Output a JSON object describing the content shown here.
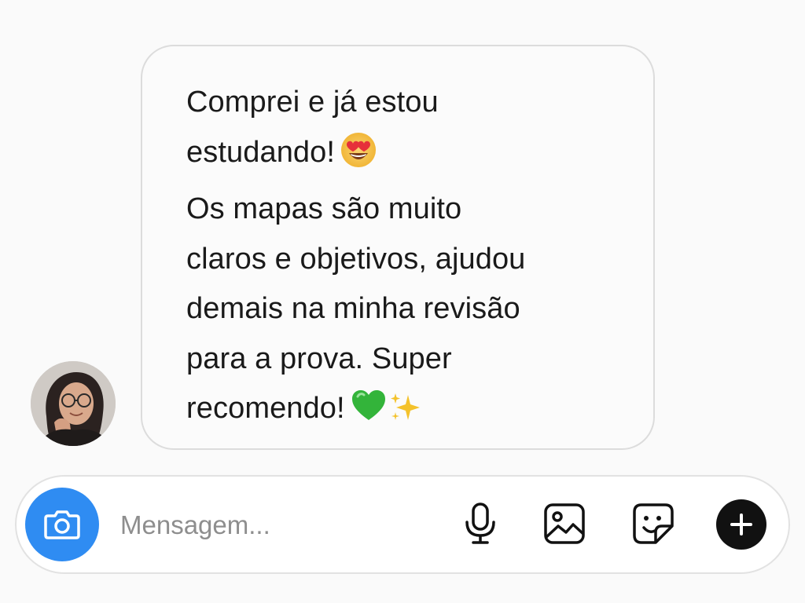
{
  "chat": {
    "message_lines": [
      "Comprei e já estou",
      "estudando!",
      "Os mapas são muito",
      "claros e objetivos, ajudou",
      "demais na minha revisão",
      "para a prova. Super",
      "recomendo!"
    ],
    "emoji_after_line2": "heart-eyes-emoji",
    "emoji_after_line7": [
      "green-heart-emoji",
      "sparkles-emoji"
    ]
  },
  "composer": {
    "placeholder": "Mensagem...",
    "value": "",
    "icons": [
      "camera-icon",
      "microphone-icon",
      "gallery-icon",
      "sticker-icon",
      "plus-icon"
    ]
  },
  "colors": {
    "camera_button": "#2f8cf2",
    "plus_button": "#111111",
    "bubble_border": "#dcdcdc"
  }
}
